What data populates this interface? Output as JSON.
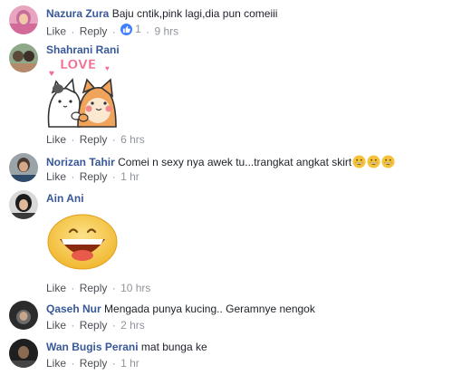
{
  "labels": {
    "like": "Like",
    "reply": "Reply",
    "sep": "·"
  },
  "comments": [
    {
      "author": "Nazura Zura",
      "text": "Baju cntik,pink lagi,dia pun comeiii",
      "like_count": "1",
      "time": "9 hrs"
    },
    {
      "author": "Shahrani Rani",
      "sticker_text": "LOVE",
      "time": "6 hrs"
    },
    {
      "author": "Norizan Tahir",
      "text": "Comei n sexy nya awek tu...trangkat angkat skirt",
      "emojis": [
        "grinning-face",
        "grinning-face",
        "grinning-face"
      ],
      "time": "1 hr"
    },
    {
      "author": "Ain Ani",
      "sticker": "big-smile-emoji",
      "time": "10 hrs"
    },
    {
      "author": "Qaseh Nur",
      "text": "Mengada punya kucing.. Geramnye nengok",
      "time": "2 hrs"
    },
    {
      "author": "Wan Bugis Perani",
      "text": "mat bunga ke",
      "time": "1 hr"
    }
  ],
  "colors": {
    "author": "#385898",
    "meta": "#90949c",
    "action": "#4b4f56",
    "like_badge": "#4080ff",
    "emoji": "#f5c33b"
  }
}
